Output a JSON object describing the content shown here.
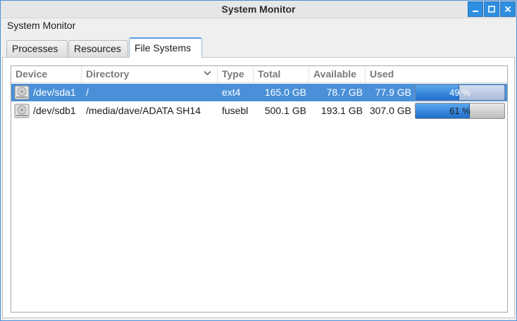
{
  "window": {
    "title": "System Monitor"
  },
  "app": {
    "title": "System Monitor"
  },
  "tabs": [
    {
      "label": "Processes",
      "active": false
    },
    {
      "label": "Resources",
      "active": false
    },
    {
      "label": "File Systems",
      "active": true
    }
  ],
  "columns": [
    "Device",
    "Directory",
    "Type",
    "Total",
    "Available",
    "Used"
  ],
  "sort_column": "Directory",
  "filesystems": [
    {
      "device": "/dev/sda1",
      "directory": "/",
      "type": "ext4",
      "total": "165.0 GB",
      "available": "78.7 GB",
      "used": "77.9 GB",
      "percent_label": "49 %",
      "percent": 49,
      "selected": true
    },
    {
      "device": "/dev/sdb1",
      "directory": "/media/dave/ADATA SH14",
      "type": "fusebl",
      "total": "500.1 GB",
      "available": "193.1 GB",
      "used": "307.0 GB",
      "percent_label": "61 %",
      "percent": 61,
      "selected": false
    }
  ],
  "icons": {
    "minimize": "minimize-icon",
    "maximize": "maximize-icon",
    "close": "close-icon",
    "device": "harddisk-icon",
    "sort": "chevron-down-icon"
  },
  "colors": {
    "accent": "#4a90d9",
    "titlebar_button": "#2e8fe0",
    "bar_fill": "#2f80dc"
  }
}
